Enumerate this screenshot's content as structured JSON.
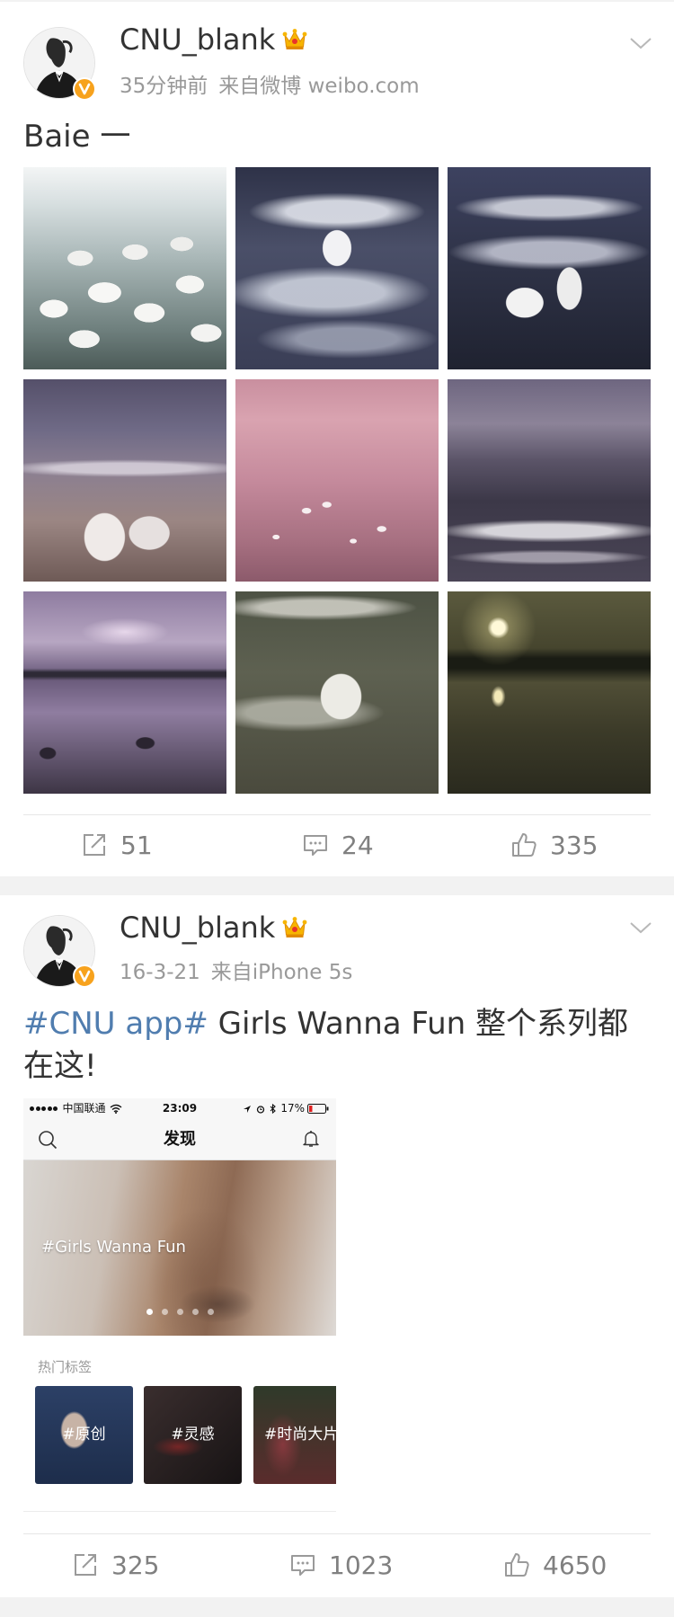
{
  "posts": [
    {
      "username": "CNU_blank",
      "time": "35分钟前",
      "source": "来自微博 weibo.com",
      "text": "Baie 一",
      "actions": {
        "reposts": "51",
        "comments": "24",
        "likes": "335"
      }
    },
    {
      "username": "CNU_blank",
      "time": "16-3-21",
      "source": "来自iPhone 5s",
      "hashtag": "#CNU app#",
      "text": " Girls Wanna Fun 整个系列都在这!",
      "embedded_screenshot": {
        "status_bar": {
          "carrier": "中国联通",
          "time": "23:09",
          "battery": "17%"
        },
        "header_title": "发现",
        "banner_caption": "#Girls Wanna Fun",
        "section_label": "热门标签",
        "tags": [
          "#原创",
          "#灵感",
          "#时尚大片"
        ]
      },
      "actions": {
        "reposts": "325",
        "comments": "1023",
        "likes": "4650"
      }
    }
  ],
  "colors": {
    "link": "#507daf",
    "verified": "#f7a21d",
    "text": "#333333",
    "meta": "#999999",
    "background": "#f2f2f2"
  },
  "icons": [
    "avatar",
    "verified-badge-icon",
    "crown-icon",
    "chevron-down-icon",
    "repost-icon",
    "comment-icon",
    "like-icon",
    "search-icon",
    "bell-icon",
    "wifi-icon",
    "battery-icon"
  ]
}
